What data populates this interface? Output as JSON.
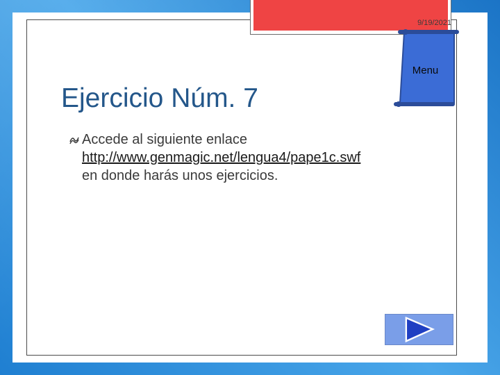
{
  "header": {
    "date": "9/19/2021",
    "menu_label": "Menu"
  },
  "slide": {
    "title": "Ejercicio Núm. 7",
    "bullet_text": "Accede al siguiente enlace",
    "link_text": "http://www.genmagic.net/lengua4/pape1c.swf",
    "tail_text": "en donde harás unos ejercicios."
  },
  "colors": {
    "background_blue": "#2f8fd8",
    "title_blue": "#24578a",
    "accent_red": "#ef4444",
    "scroll_blue": "#3b6cd6",
    "button_blue": "#7a9ee8"
  },
  "icons": {
    "bullet": "wave-bullet-icon",
    "next": "play-triangle-icon"
  }
}
